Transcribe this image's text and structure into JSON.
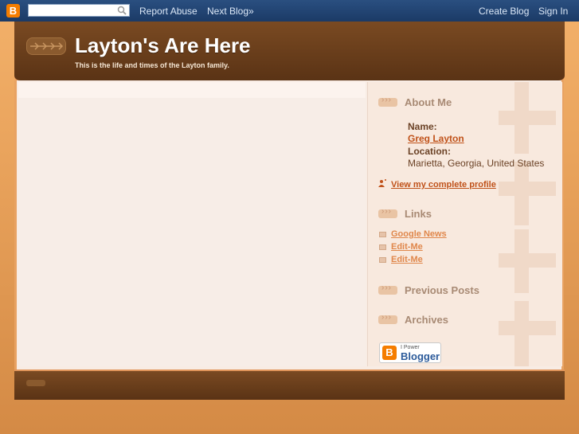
{
  "navbar": {
    "logo": "B",
    "search_value": "",
    "report_abuse": "Report Abuse",
    "next_blog": "Next Blog»",
    "create_blog": "Create Blog",
    "sign_in": "Sign In"
  },
  "header": {
    "title": "Layton's Are Here",
    "description": "This is the life and times of the Layton family."
  },
  "sidebar": {
    "about_heading": "About Me",
    "name_label": "Name:",
    "name_value": "Greg Layton",
    "location_label": "Location:",
    "location_value": "Marietta, Georgia, United States",
    "profile_link": "View my complete profile",
    "links_heading": "Links",
    "links": [
      "Google News",
      "Edit-Me",
      "Edit-Me"
    ],
    "previous_heading": "Previous Posts",
    "archives_heading": "Archives",
    "badge_small": "I Power",
    "badge_big": "Blogger",
    "badge_logo": "B"
  },
  "colors": {
    "navbar": "#1b3a66",
    "header": "#5a3315",
    "accent_link": "#c0521a",
    "background": "#e9a35c"
  }
}
